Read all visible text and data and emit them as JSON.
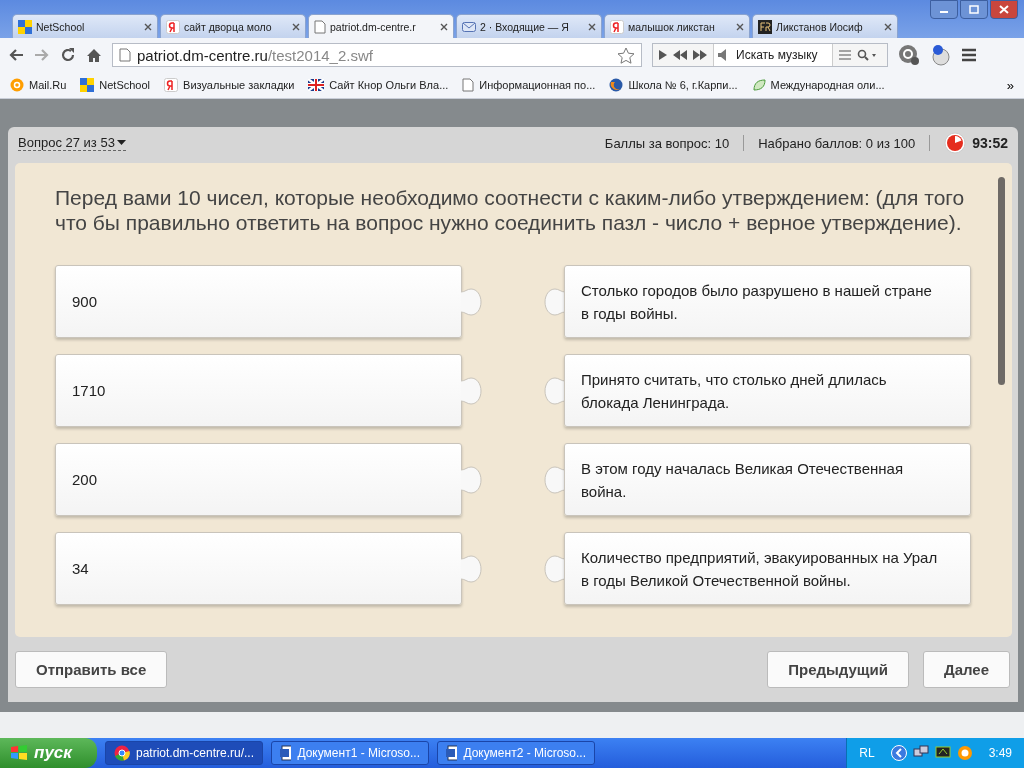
{
  "browser": {
    "tabs": [
      {
        "kind": "netschool",
        "title": "NetSchool",
        "selected": false
      },
      {
        "kind": "yandex",
        "title": "сайт дворца моло",
        "selected": false
      },
      {
        "kind": "page",
        "title": "patriot.dm-centre.r",
        "selected": true
      },
      {
        "kind": "mail",
        "title": "2 · Входящие — Я",
        "selected": false
      },
      {
        "kind": "yandex",
        "title": "малышок ликстан",
        "selected": false
      },
      {
        "kind": "fr",
        "title": "Ликстанов Иосиф",
        "selected": false
      }
    ],
    "address": {
      "host": "patriot.dm-centre.ru",
      "path": "/test2014_2.swf"
    },
    "music_search": {
      "placeholder": "Искать музыку"
    },
    "bookmarks": [
      {
        "kind": "mailru",
        "label": "Mail.Ru"
      },
      {
        "kind": "netschool",
        "label": "NetSchool"
      },
      {
        "kind": "yandex",
        "label": "Визуальные закладки"
      },
      {
        "kind": "flag",
        "label": "Сайт Кнор Ольги Вла..."
      },
      {
        "kind": "page",
        "label": "Информационная по..."
      },
      {
        "kind": "firefox",
        "label": "Школа № 6, г.Карпи..."
      },
      {
        "kind": "leaf",
        "label": "Международная оли..."
      }
    ],
    "more": "»"
  },
  "quiz": {
    "question_nav": "Вопрос 27 из 53",
    "points_per_question": "Баллы за вопрос: 10",
    "score": "Набрано баллов: 0 из 100",
    "timer": "93:52",
    "question": "Перед вами 10 чисел, которые необходимо соотнести с каким-либо утверждением: (для того что бы правильно ответить на вопрос нужно соединить пазл - число + верное утверждение).",
    "pairs": [
      {
        "number": "900",
        "statement": "Столько городов было разрушено в нашей стране в годы войны."
      },
      {
        "number": "1710",
        "statement": "Принято считать, что столько дней длилась блокада Ленинграда."
      },
      {
        "number": "200",
        "statement": "В этом году началась Великая Отечественная война."
      },
      {
        "number": "34",
        "statement": "Количество предприятий, эвакуированных на Урал в годы Великой Отечественной войны."
      }
    ],
    "submit_all": "Отправить все",
    "previous": "Предыдущий",
    "next": "Далее"
  },
  "taskbar": {
    "start": "пуск",
    "tasks": [
      {
        "kind": "chrome",
        "label": "patriot.dm-centre.ru/...",
        "selected": true
      },
      {
        "kind": "word",
        "label": "Документ1 - Microso...",
        "selected": false
      },
      {
        "kind": "word",
        "label": "Документ2 - Microso...",
        "selected": false
      }
    ],
    "language": "RL",
    "clock": "3:49"
  }
}
